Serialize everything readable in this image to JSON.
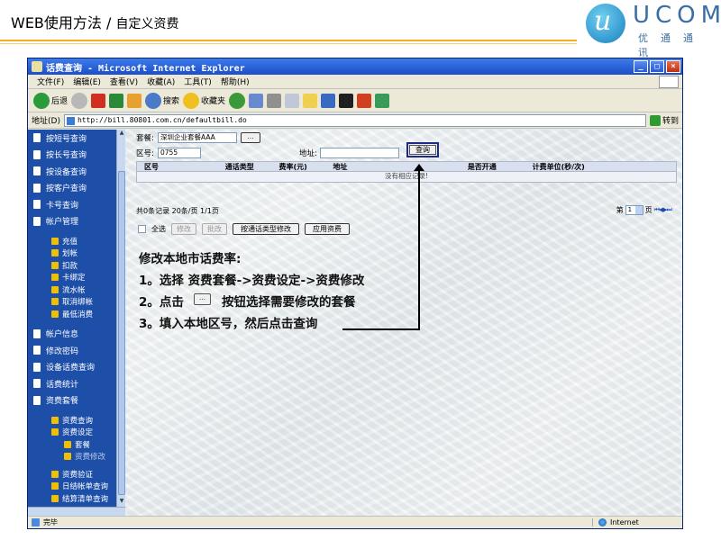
{
  "slide": {
    "title": "WEB使用方法 / ",
    "subtitle": "自定义资费",
    "logo_text": "UCOM",
    "logo_sub": "优通通讯",
    "logo_glyph": "u"
  },
  "browser": {
    "window_title": "话费查询 - Microsoft Internet Explorer",
    "menu": [
      "文件(F)",
      "编辑(E)",
      "查看(V)",
      "收藏(A)",
      "工具(T)",
      "帮助(H)"
    ],
    "toolbar": {
      "back": "后退",
      "search": "搜索",
      "favorites": "收藏夹"
    },
    "address_label": "地址(D)",
    "url": "http://bill.80801.com.cn/defaultbill.do",
    "go_label": "转到",
    "status_text": "完毕",
    "zone_text": "Internet"
  },
  "sidebar": {
    "items_top": [
      "按短号查询",
      "按长号查询",
      "按设备查询",
      "按客户查询",
      "卡号查询",
      "帐户管理"
    ],
    "account_sub": [
      "充值",
      "划帐",
      "扣款",
      "卡绑定",
      "流水帐",
      "取消绑帐",
      "最低消费"
    ],
    "items_mid": [
      "帐户信息",
      "修改密码",
      "设备话费查询",
      "话费统计",
      "资费套餐"
    ],
    "tariff_sub": [
      "资费查询",
      "资费设定"
    ],
    "tariff_sub3": [
      "套餐",
      "资费修改"
    ],
    "tariff_sub_after": [
      "资费验证",
      "日结帐单查询",
      "结算清单查询"
    ]
  },
  "form": {
    "package_label": "套餐:",
    "package_value": "深圳企业套餐AAA",
    "dots_label": "…",
    "area_label": "区号:",
    "area_value": "0755",
    "address_label": "地址:",
    "address_value": "",
    "query_label": "查询"
  },
  "table": {
    "headers": [
      "区号",
      "通话类型",
      "费率(元)",
      "地址",
      "是否开通",
      "计费单位(秒/次)"
    ],
    "empty_text": "没有相应记录!"
  },
  "pagination": {
    "summary": "共0条记录  20条/页  1/1页",
    "page_prefix": "第",
    "page_value": "1",
    "page_suffix": "页",
    "nav_symbols": "⏮◀▶⏭"
  },
  "actions": {
    "select_all": "全选",
    "modify": "修改",
    "batch_modify": "批改",
    "by_type_modify": "按通话类型修改",
    "apply_tariff": "应用资费"
  },
  "instructions": {
    "heading": "修改本地市话费率:",
    "step1": "1。选择 资费套餐->资费设定->资费修改",
    "step2_a": "2。点击",
    "step2_dots": "…",
    "step2_b": "按钮选择需要修改的套餐",
    "step3": "3。填入本地区号，然后点击查询"
  },
  "colors": {
    "accent_rule": "#f0b020",
    "sidebar_bg": "#1d4fa8",
    "title_bar": "#2a5ad0",
    "logo_blue": "#3a6ea5"
  }
}
